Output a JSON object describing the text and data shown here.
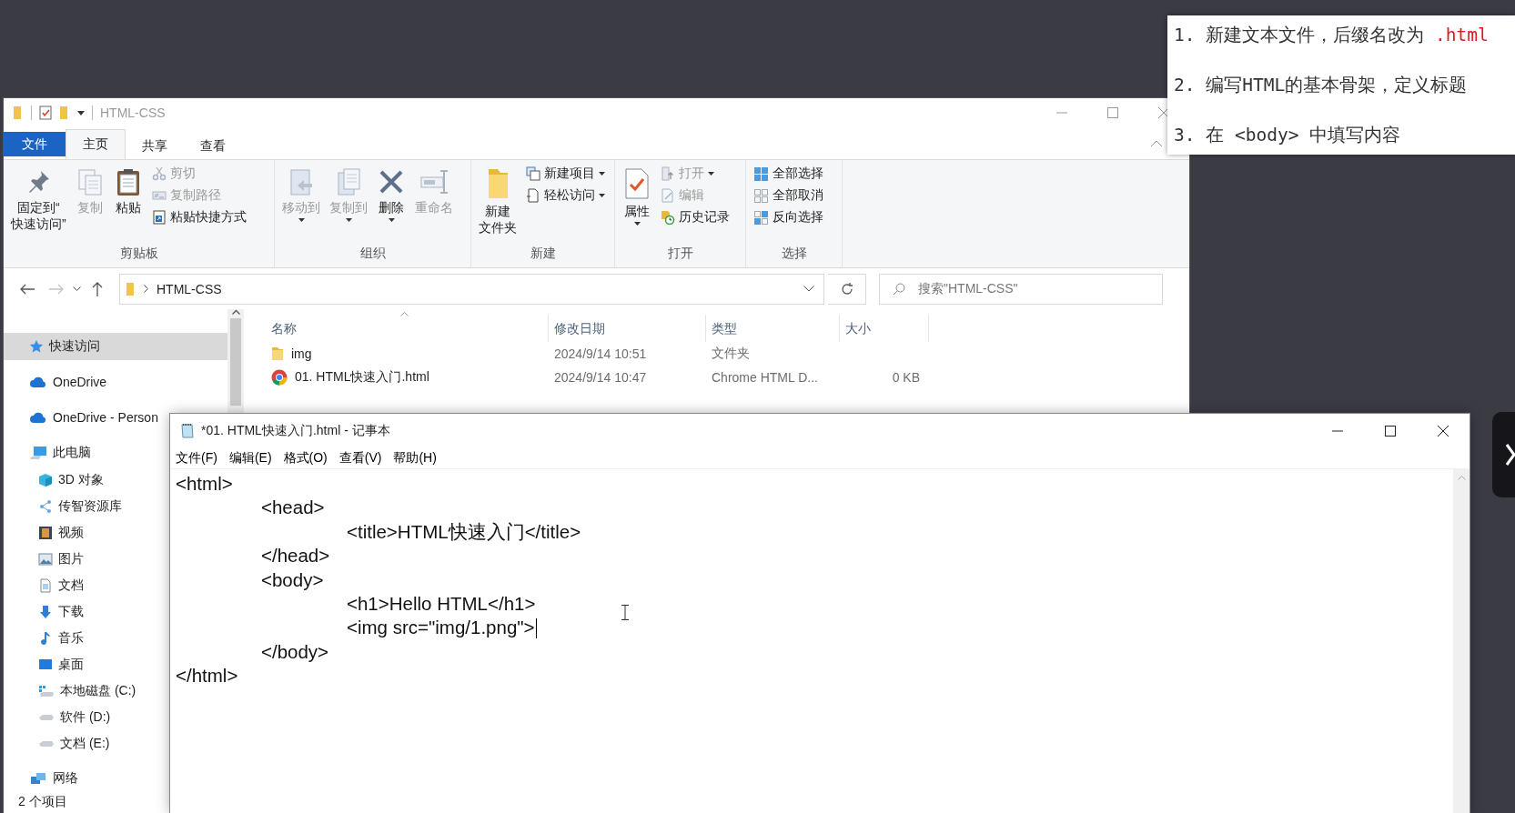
{
  "explorer": {
    "title": "HTML-CSS",
    "tabs": [
      {
        "label": "文件",
        "kind": "file",
        "selected": false
      },
      {
        "label": "主页",
        "kind": "tab",
        "selected": true
      },
      {
        "label": "共享",
        "kind": "tab",
        "selected": false
      },
      {
        "label": "查看",
        "kind": "tab",
        "selected": false
      }
    ],
    "ribbon_groups": [
      {
        "label": "剪贴板",
        "items": [
          {
            "label_lines": [
              "固定到“",
              "快速访问”"
            ],
            "kind": "large",
            "disabled": false,
            "dropdown": false
          },
          {
            "label": "复制",
            "kind": "large",
            "disabled": true,
            "dropdown": false
          },
          {
            "label": "粘贴",
            "kind": "large",
            "disabled": false,
            "dropdown": false
          },
          {
            "label": "剪切",
            "kind": "small",
            "disabled": true,
            "dropdown": false
          },
          {
            "label": "复制路径",
            "kind": "small",
            "disabled": true,
            "dropdown": false
          },
          {
            "label": "粘贴快捷方式",
            "kind": "small",
            "disabled": false,
            "dropdown": false
          }
        ]
      },
      {
        "label": "组织",
        "items": [
          {
            "label": "移动到",
            "kind": "large",
            "disabled": true,
            "dropdown": true
          },
          {
            "label": "复制到",
            "kind": "large",
            "disabled": true,
            "dropdown": true
          },
          {
            "label": "删除",
            "kind": "large",
            "disabled": false,
            "dropdown": true
          },
          {
            "label": "重命名",
            "kind": "large",
            "disabled": true,
            "dropdown": false
          }
        ]
      },
      {
        "label": "新建",
        "items": [
          {
            "label_lines": [
              "新建",
              "文件夹"
            ],
            "kind": "large",
            "disabled": false,
            "dropdown": false
          },
          {
            "label": "新建项目",
            "kind": "small",
            "disabled": false,
            "dropdown": true
          },
          {
            "label": "轻松访问",
            "kind": "small",
            "disabled": false,
            "dropdown": true
          }
        ]
      },
      {
        "label": "打开",
        "items": [
          {
            "label": "属性",
            "kind": "large",
            "disabled": false,
            "dropdown": true
          },
          {
            "label": "打开",
            "kind": "small",
            "disabled": true,
            "dropdown": true
          },
          {
            "label": "编辑",
            "kind": "small",
            "disabled": true,
            "dropdown": false
          },
          {
            "label": "历史记录",
            "kind": "small",
            "disabled": false,
            "dropdown": false
          }
        ]
      },
      {
        "label": "选择",
        "items": [
          {
            "label": "全部选择",
            "kind": "small",
            "disabled": false,
            "dropdown": false
          },
          {
            "label": "全部取消",
            "kind": "small",
            "disabled": false,
            "dropdown": false
          },
          {
            "label": "反向选择",
            "kind": "small",
            "disabled": false,
            "dropdown": false
          }
        ]
      }
    ],
    "back": {
      "disabled": false
    },
    "forward": {
      "disabled": true
    },
    "address": "HTML-CSS",
    "search": {
      "placeholder": "搜索\"HTML-CSS\""
    },
    "sidebar": {
      "items": [
        {
          "label": "快速访问",
          "selected": true
        },
        {
          "label": "OneDrive",
          "selected": false
        },
        {
          "label": "OneDrive - Person",
          "selected": false
        },
        {
          "label": "此电脑",
          "selected": false,
          "children": [
            {
              "label": "3D 对象",
              "selected": false
            },
            {
              "label": "传智资源库",
              "selected": false
            },
            {
              "label": "视频",
              "selected": false
            },
            {
              "label": "图片",
              "selected": false
            },
            {
              "label": "文档",
              "selected": false
            },
            {
              "label": "下载",
              "selected": false
            },
            {
              "label": "音乐",
              "selected": false
            },
            {
              "label": "桌面",
              "selected": false
            },
            {
              "label": "本地磁盘 (C:)",
              "selected": false
            },
            {
              "label": "软件 (D:)",
              "selected": false
            },
            {
              "label": "文档 (E:)",
              "selected": false
            }
          ]
        },
        {
          "label": "网络",
          "selected": false
        }
      ]
    },
    "file_list": {
      "columns": [
        "名称",
        "修改日期",
        "类型",
        "大小"
      ],
      "rows": [
        {
          "kind": "folder",
          "name": "img",
          "modified": "2024/9/14 10:51",
          "type": "文件夹",
          "size": ""
        },
        {
          "kind": "chrome-html",
          "name": "01. HTML快速入门.html",
          "modified": "2024/9/14 10:47",
          "type": "Chrome HTML D...",
          "size": "0 KB"
        }
      ]
    },
    "status_bar": "2 个项目"
  },
  "notepad": {
    "title": "*01. HTML快速入门.html - 记事本",
    "menu": [
      "文件(F)",
      "编辑(E)",
      "格式(O)",
      "查看(V)",
      "帮助(H)"
    ],
    "lines": [
      {
        "text": "<html>",
        "caret": false
      },
      {
        "text": "\t<head>",
        "caret": false
      },
      {
        "text": "\t\t<title>HTML快速入门</title>",
        "caret": false
      },
      {
        "text": "\t</head>",
        "caret": false
      },
      {
        "text": "\t<body>",
        "caret": false
      },
      {
        "text": "\t\t<h1>Hello HTML</h1>",
        "caret": false
      },
      {
        "text": "\t\t<img src=\"img/1.png\">",
        "caret": true
      },
      {
        "text": "\t</body>",
        "caret": false
      },
      {
        "text": "</html>",
        "caret": false
      }
    ]
  },
  "note": {
    "items": [
      {
        "text": "1. 新建文本文件，后缀名改为 ",
        "code": ".html"
      },
      {
        "text": "2. 编写HTML的基本骨架，定义标题"
      },
      {
        "text": "3. 在 <body> 中填写内容"
      }
    ]
  }
}
